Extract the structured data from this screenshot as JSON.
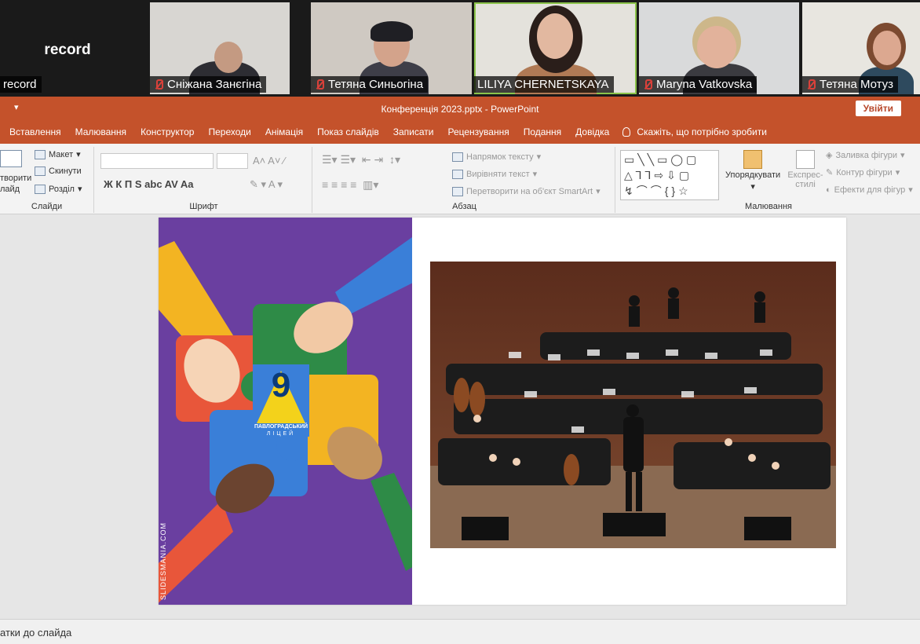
{
  "participants": [
    {
      "name": "record",
      "muted": false,
      "big_label": "record"
    },
    {
      "name": "Сніжана Занєгіна",
      "muted": true
    },
    {
      "name": "Тетяна Синьогіна",
      "muted": true
    },
    {
      "name": "LILIYA CHERNETSKAYA",
      "muted": false,
      "active": true
    },
    {
      "name": "Maryna Vatkovska",
      "muted": true
    },
    {
      "name": "Тетяна Мотуз",
      "muted": true
    }
  ],
  "powerpoint": {
    "doc_title": "Конференція 2023.pptx  -  PowerPoint",
    "sign_in": "Увійти",
    "tabs": [
      "Вставлення",
      "Малювання",
      "Конструктор",
      "Переходи",
      "Анімація",
      "Показ слайдів",
      "Записати",
      "Рецензування",
      "Подання",
      "Довідка"
    ],
    "tell_me": "Скажіть, що потрібно зробити",
    "ribbon": {
      "slides": {
        "new_slide": "творити\nлайд",
        "layout": "Макет",
        "reset": "Скинути",
        "section": "Розділ",
        "label": "Слайди"
      },
      "font": {
        "label": "Шрифт",
        "buttons": "Ж   К   П   S   abc   AV   Aa"
      },
      "paragraph": {
        "label": "Абзац",
        "text_direction": "Напрямок тексту",
        "align_text": "Вирівняти текст",
        "smartart": "Перетворити на об'єкт SmartArt"
      },
      "drawing": {
        "label": "Малювання",
        "arrange": "Упорядкувати",
        "quick_styles": "Експрес-стилі",
        "fill": "Заливка фігури",
        "outline": "Контур фігури",
        "effects": "Ефекти для фігур"
      }
    },
    "notes_text": "атки до слайда"
  },
  "slide": {
    "watermark": "SLIDESMANIA.COM",
    "logo": {
      "number": "9",
      "line1": "ПАВЛОГРАДСЬКИЙ",
      "line2": "ЛІЦЕЙ"
    }
  },
  "colors": {
    "ppt_accent": "#c4522b",
    "slide_purple": "#6a3fa0",
    "puzzle": [
      "#e8563a",
      "#2e8b47",
      "#f3b422",
      "#3a7fd8"
    ]
  }
}
